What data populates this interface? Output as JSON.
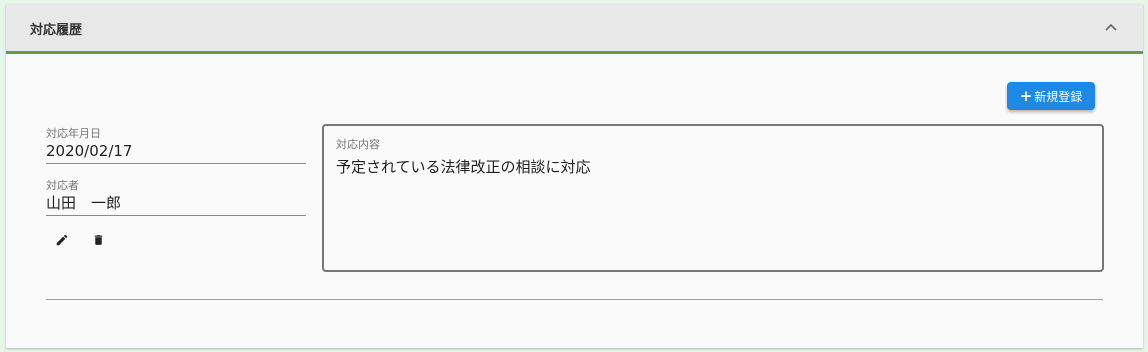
{
  "panel": {
    "title": "対応履歴",
    "collapse_icon": "chevron-up-icon"
  },
  "toolbar": {
    "new_button_plus": "+",
    "new_button_label": "新規登録"
  },
  "record": {
    "date_label": "対応年月日",
    "date_value": "2020/02/17",
    "person_label": "対応者",
    "person_value": "山田　一郎",
    "content_label": "対応内容",
    "content_value": "予定されている法律改正の相談に対応",
    "edit_icon": "pencil-icon",
    "delete_icon": "trash-icon"
  },
  "colors": {
    "header_accent": "#6b9a3f",
    "primary_button": "#1e88e5"
  }
}
